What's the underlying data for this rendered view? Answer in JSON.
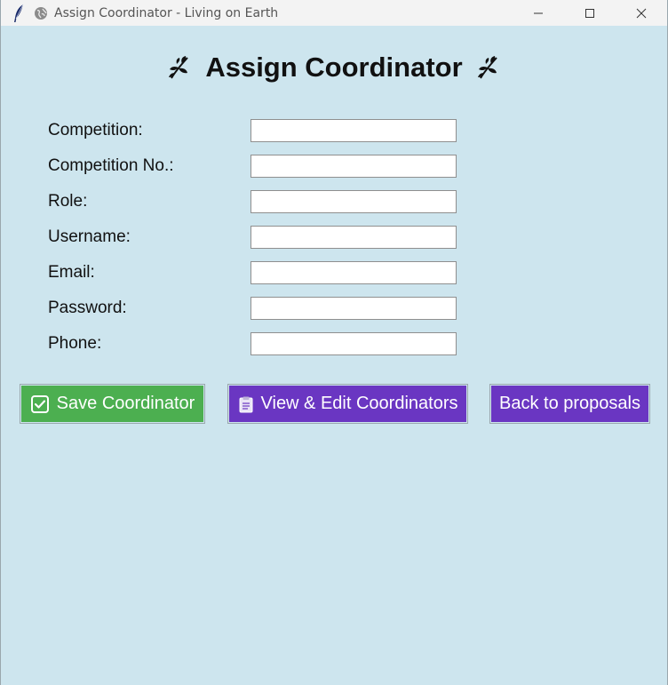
{
  "window": {
    "title": "Assign Coordinator - Living on Earth"
  },
  "heading": {
    "text": "Assign Coordinator"
  },
  "form": {
    "fields": [
      {
        "label": "Competition:",
        "value": ""
      },
      {
        "label": "Competition No.:",
        "value": ""
      },
      {
        "label": "Role:",
        "value": ""
      },
      {
        "label": "Username:",
        "value": ""
      },
      {
        "label": "Email:",
        "value": ""
      },
      {
        "label": "Password:",
        "value": ""
      },
      {
        "label": "Phone:",
        "value": ""
      }
    ]
  },
  "buttons": {
    "save": "Save Coordinator",
    "view_edit": "View & Edit Coordinators",
    "back": "Back to proposals"
  },
  "icons": {
    "app": "feather-icon",
    "title": "globe-icon",
    "heading": "leaf-icon",
    "save": "checkbox-icon",
    "view_edit": "clipboard-icon"
  },
  "colors": {
    "background": "#cde5ee",
    "save_button": "#4caf50",
    "purple_button": "#6a36c2"
  }
}
